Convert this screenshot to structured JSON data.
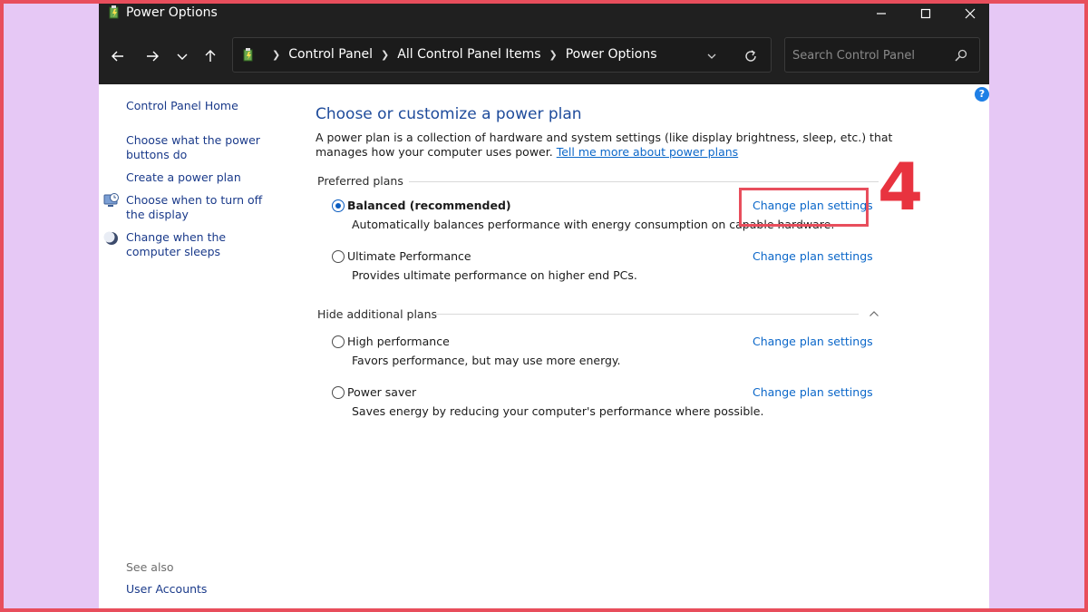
{
  "window": {
    "title": "Power Options"
  },
  "address": {
    "crumbs": [
      "Control Panel",
      "All Control Panel Items",
      "Power Options"
    ]
  },
  "search": {
    "placeholder": "Search Control Panel"
  },
  "sidebar": {
    "home": "Control Panel Home",
    "links": [
      "Choose what the power buttons do",
      "Create a power plan",
      "Choose when to turn off the display",
      "Change when the computer sleeps"
    ],
    "see_also_label": "See also",
    "see_also_links": [
      "User Accounts"
    ]
  },
  "main": {
    "title": "Choose or customize a power plan",
    "description": "A power plan is a collection of hardware and system settings (like display brightness, sleep, etc.) that manages how your computer uses power.",
    "learn_more": "Tell me more about power plans",
    "preferred_header": "Preferred plans",
    "additional_header": "Hide additional plans",
    "plans": [
      {
        "name": "Balanced (recommended)",
        "description": "Automatically balances performance with energy consumption on capable hardware.",
        "link": "Change plan settings",
        "selected": true
      },
      {
        "name": "Ultimate Performance",
        "description": "Provides ultimate performance on higher end PCs.",
        "link": "Change plan settings",
        "selected": false
      },
      {
        "name": "High performance",
        "description": "Favors performance, but may use more energy.",
        "link": "Change plan settings",
        "selected": false
      },
      {
        "name": "Power saver",
        "description": "Saves energy by reducing your computer's performance where possible.",
        "link": "Change plan settings",
        "selected": false
      }
    ]
  },
  "annotation": {
    "step": "4",
    "accent": "#e84e5c"
  }
}
